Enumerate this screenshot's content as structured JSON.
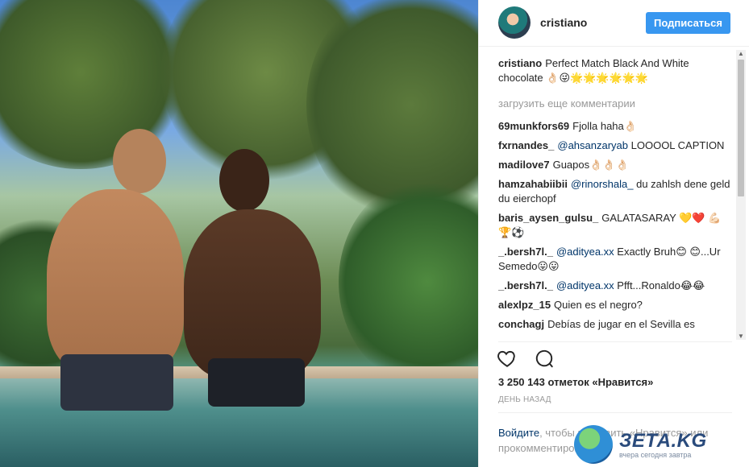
{
  "post": {
    "username": "cristiano",
    "follow_label": "Подписаться",
    "caption": {
      "user": "cristiano",
      "text": "Perfect Match Black And White chocolate 👌🏻😜🌟🌟🌟🌟🌟🌟"
    },
    "load_more": "загрузить еще комментарии",
    "comments": [
      {
        "user": "69munkfors69",
        "mention": "",
        "text": "Fjolla haha👌🏻"
      },
      {
        "user": "fxrnandes_",
        "mention": "@ahsanzaryab",
        "text": " LOOOOL CAPTION"
      },
      {
        "user": "madilove7",
        "mention": "",
        "text": "Guapos👌🏻👌🏻👌🏻"
      },
      {
        "user": "hamzahabiibii",
        "mention": "@rinorshala_",
        "text": " du zahlsh dene geld du eierchopf"
      },
      {
        "user": "baris_aysen_gulsu_",
        "mention": "",
        "text": "GALATASARAY 💛❤️ 💪🏻🏆⚽"
      },
      {
        "user": "_.bersh7l._",
        "mention": "@adityea.xx",
        "text": " Exactly Bruh😊 😊...Ur Semedo😛😛"
      },
      {
        "user": "_.bersh7l._",
        "mention": "@adityea.xx",
        "text": " Pfft...Ronaldo😂😂"
      },
      {
        "user": "alexlpz_15",
        "mention": "",
        "text": "Quien es el negro?"
      },
      {
        "user": "conchagj",
        "mention": "",
        "text": "Debías de jugar en el Sevilla es"
      }
    ],
    "likes": "3 250 143 отметок «Нравится»",
    "time": "день назад",
    "login": {
      "link": "Войдите",
      "text": ", чтобы поставить «Нравится» или прокомментировать."
    }
  },
  "watermark": {
    "title": "ЗЕТА.KG",
    "subtitle": "вчера сегодня завтра"
  },
  "icons": {
    "like": "heart-icon",
    "comment": "comment-icon"
  }
}
